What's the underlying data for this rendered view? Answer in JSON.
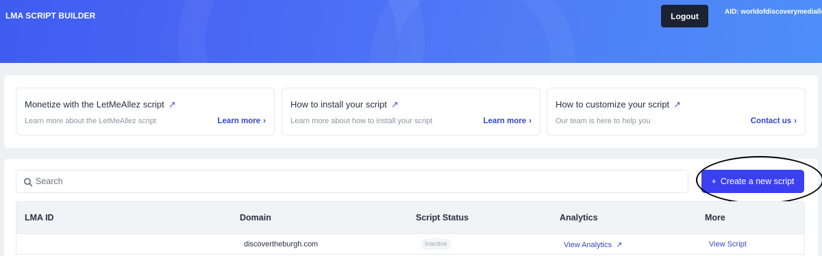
{
  "header": {
    "app_title": "LMA SCRIPT BUILDER",
    "logout_label": "Logout",
    "aid_text": "AID: worldofdiscoverymediallc"
  },
  "info_cards": [
    {
      "title": "Monetize with the LetMeAllez script",
      "description": "Learn more about the LetMeAllez script",
      "link_label": "Learn more"
    },
    {
      "title": "How to install your script",
      "description": "Learn more about how to install your script",
      "link_label": "Learn more"
    },
    {
      "title": "How to customize your script",
      "description": "Our team is here to help you",
      "link_label": "Contact us"
    }
  ],
  "icons": {
    "external": "↗",
    "chevron": "›",
    "plus": "+"
  },
  "search": {
    "placeholder": "Search"
  },
  "create_button_label": "Create a new script",
  "table": {
    "columns": [
      "LMA ID",
      "Domain",
      "Script Status",
      "Analytics",
      "More"
    ],
    "rows": [
      {
        "lma_id": "",
        "domain": "discovertheburgh.com",
        "status": "Inactive",
        "analytics": "View Analytics",
        "more": "View Script"
      }
    ]
  },
  "colors": {
    "header_gradient_start": "#3f5cf0",
    "header_gradient_end": "#4d8ff8",
    "primary_button": "#3a3ff0",
    "logout_button": "#1b2233",
    "link": "#3546c8"
  }
}
